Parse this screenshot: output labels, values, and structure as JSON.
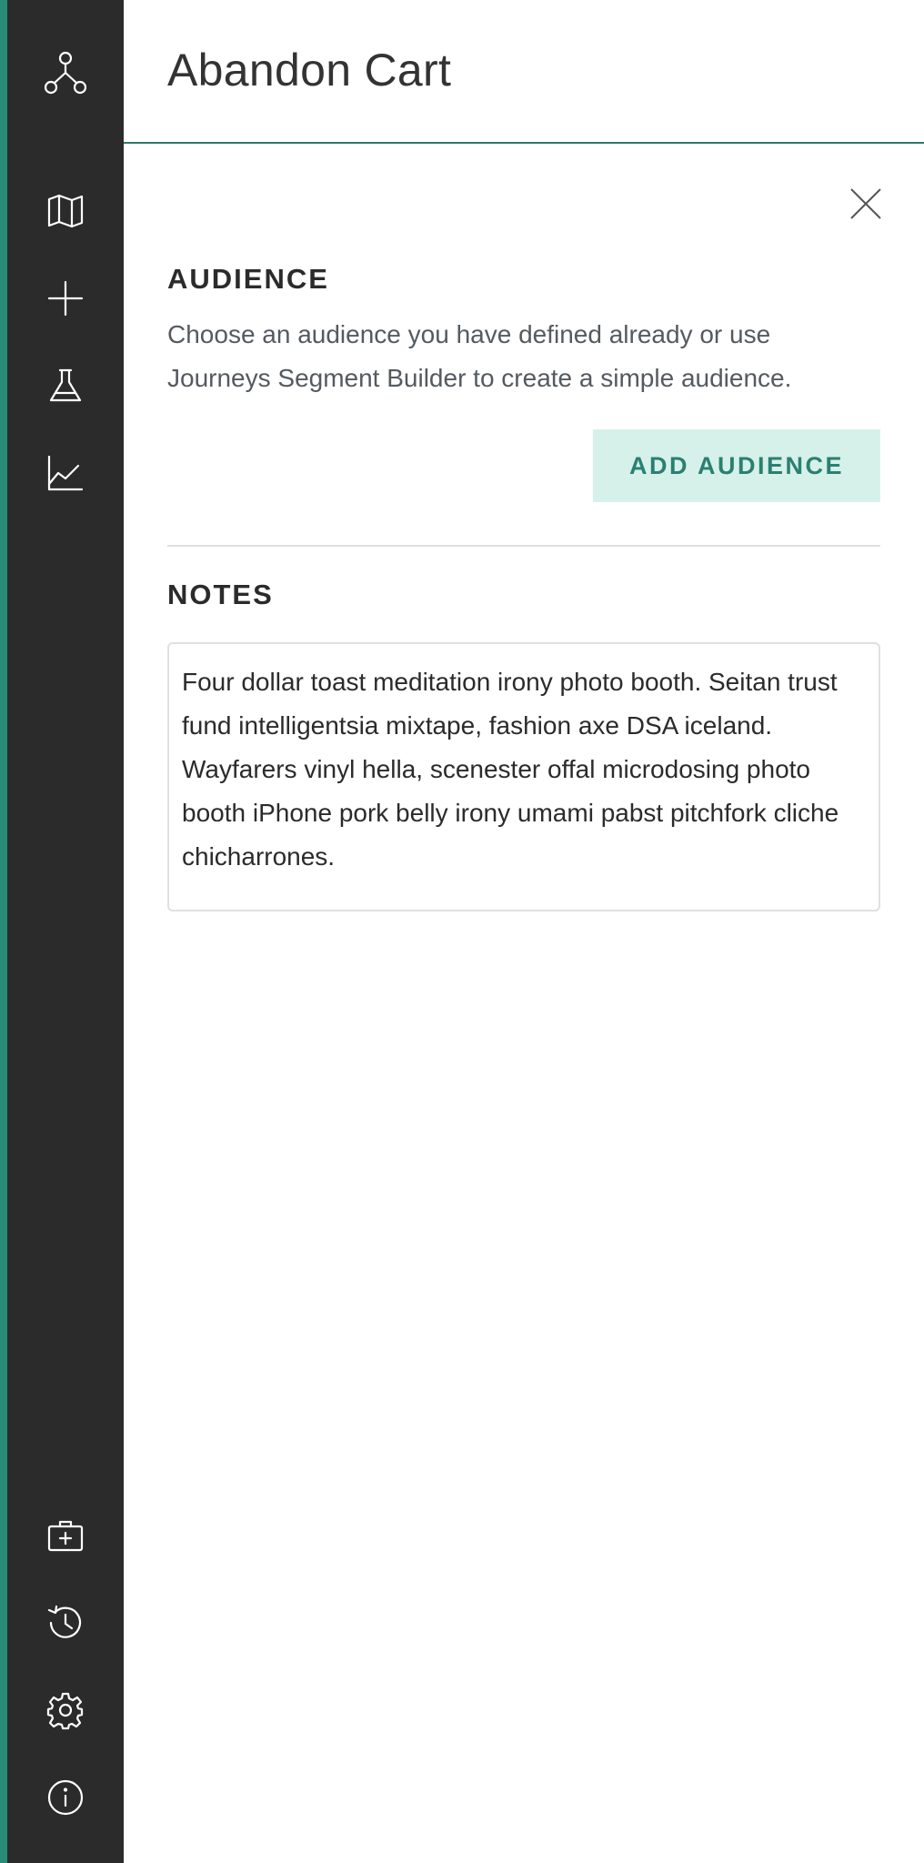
{
  "header": {
    "title": "Abandon Cart"
  },
  "sidebar": {
    "top_icons": [
      "journey-map-icon",
      "add-icon",
      "experiment-flask-icon",
      "analytics-chart-icon"
    ],
    "bottom_icons": [
      "medical-kit-icon",
      "history-icon",
      "settings-gear-icon",
      "info-icon"
    ]
  },
  "audience": {
    "heading": "AUDIENCE",
    "description": "Choose an audience you have defined already or use Journeys Segment Builder to create a simple audience.",
    "button_label": "ADD AUDIENCE"
  },
  "notes": {
    "heading": "NOTES",
    "text": "Four dollar toast meditation irony photo booth. Seitan trust fund intelligentsia mixtape, fashion axe DSA iceland. Wayfarers vinyl hella, scenester offal microdosing photo booth iPhone pork belly irony umami pabst pitchfork cliche chicharrones."
  },
  "colors": {
    "sidebar_bg": "#2b2b2b",
    "accent": "#2a8c78",
    "button_bg": "#d6f1ea",
    "button_text": "#2a8071"
  }
}
